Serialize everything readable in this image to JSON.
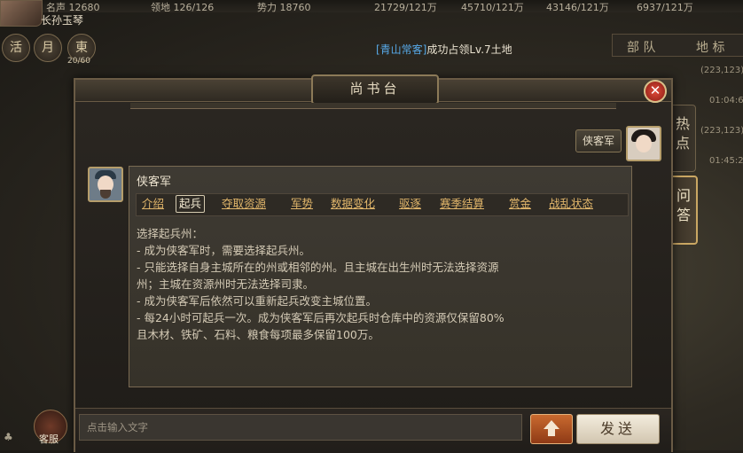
{
  "topbar": {
    "stat1": "名声 12680",
    "stat2": "领地 126/126",
    "stat3": "势力 18760",
    "stat4": "21729/121万",
    "stat5": "45710/121万",
    "stat6": "43146/121万",
    "stat7": "6937/121万"
  },
  "player_name": "长孙玉琴",
  "controls": [
    "活",
    "月",
    "東"
  ],
  "controls_count": "20/60",
  "notice": {
    "prefix": "[青山常客]",
    "suffix": "成功占领Lv.7土地"
  },
  "right_panel": {
    "tabs": [
      "部 队",
      "地 标"
    ],
    "coords": [
      "(223,123)",
      "01:04:6",
      "(223,123)",
      "01:45:2"
    ]
  },
  "side_tabs": [
    "热\n点",
    "问\n答"
  ],
  "help_label": "客服",
  "modal": {
    "title": "尚书台",
    "close_symbol": "✕",
    "user_message": "侠客军",
    "reply": {
      "name": "侠客军",
      "tabs": [
        "介绍",
        "起兵",
        "夺取资源",
        "军势",
        "数据变化",
        "驱逐",
        "赛季结算",
        "赏金",
        "战乱状态"
      ],
      "active_tab": "起兵",
      "lines": [
        "选择起兵州：",
        "- 成为侠客军时，需要选择起兵州。",
        "- 只能选择自身主城所在的州或相邻的州。且主城在出生州时无法选择资源",
        "州；主城在资源州时无法选择司隶。",
        "- 成为侠客军后依然可以重新起兵改变主城位置。",
        "- 每24小时可起兵一次。成为侠客军后再次起兵时仓库中的资源仅保留80%",
        "且木材、铁矿、石料、粮食每项最多保留100万。"
      ]
    },
    "input": {
      "placeholder": "点击输入文字",
      "value": ""
    },
    "send_label": "发送"
  },
  "colors": {
    "accent_gold": "#e0b56a",
    "close_red": "#d03c2c",
    "up_button": "#c0602a",
    "notice_blue": "#57a9e8"
  }
}
